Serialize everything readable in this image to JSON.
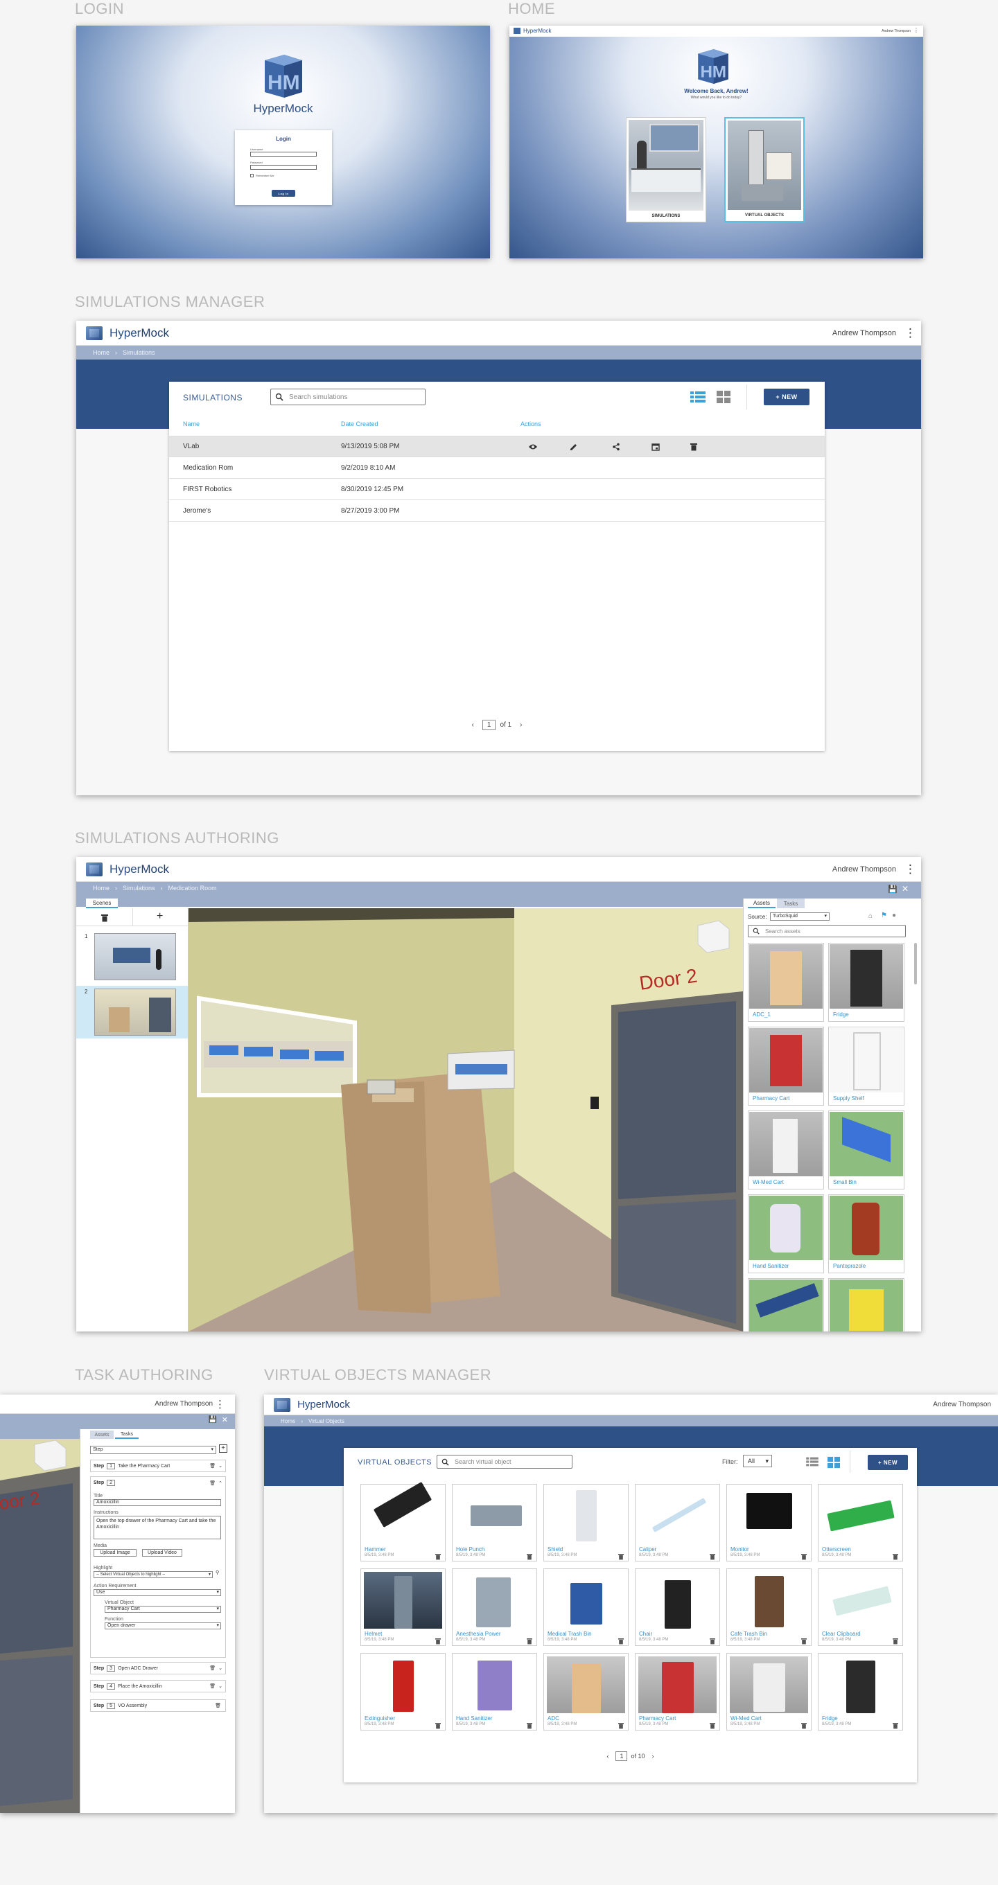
{
  "sections": {
    "login": "LOGIN",
    "home": "HOME",
    "sim_manager": "SIMULATIONS MANAGER",
    "sim_authoring": "SIMULATIONS AUTHORING",
    "task_authoring": "TASK AUTHORING",
    "vo_manager": "VIRTUAL OBJECTS MANAGER"
  },
  "app": {
    "brand_a": "Hyper",
    "brand_b": "Mock",
    "user": "Andrew Thompson"
  },
  "login": {
    "title": "Login",
    "username_label": "Username",
    "password_label": "Password",
    "remember": "Remember Me",
    "button": "Log In"
  },
  "home": {
    "welcome": "Welcome Back, Andrew!",
    "question": "What would you like to do today?",
    "card1": "SIMULATIONS",
    "card2": "VIRTUAL OBJECTS"
  },
  "sim_manager": {
    "breadcrumb": [
      "Home",
      "Simulations"
    ],
    "title": "SIMULATIONS",
    "search_placeholder": "Search simulations",
    "new_label": "+ NEW",
    "columns": [
      "Name",
      "Date Created",
      "Actions"
    ],
    "rows": [
      {
        "name": "VLab",
        "date": "9/13/2019 5:08 PM"
      },
      {
        "name": "Medication Rom",
        "date": "9/2/2019 8:10 AM"
      },
      {
        "name": "FIRST Robotics",
        "date": "8/30/2019 12:45 PM"
      },
      {
        "name": "Jerome's",
        "date": "8/27/2019 3:00 PM"
      }
    ],
    "page": "1",
    "page_of": "of 1"
  },
  "authoring": {
    "breadcrumb": [
      "Home",
      "Simulations",
      "Medication Room"
    ],
    "tab_scenes": "Scenes",
    "scene_numbers": [
      "1",
      "2"
    ],
    "door_label": "Door 2",
    "tab_assets": "Assets",
    "tab_tasks": "Tasks",
    "source_label": "Source:",
    "source_value": "TurboSquid",
    "asset_search": "Search assets",
    "assets": [
      "ADC_1",
      "Fridge",
      "Pharmacy Cart",
      "Supply Shelf",
      "Wi-Med Cart",
      "Small Bin",
      "Hand Sanitizer",
      "Pantoprazole",
      "",
      ""
    ]
  },
  "task": {
    "user": "Andrew Thompson",
    "door_label": "oor 2",
    "tab_assets": "Assets",
    "tab_tasks": "Tasks",
    "step_select": "Step",
    "step_word": "Step",
    "steps": [
      {
        "n": "1",
        "text": "Take the Pharmacy Cart"
      },
      {
        "n": "2",
        "text": ""
      },
      {
        "n": "3",
        "text": "Open ADC Drawer"
      },
      {
        "n": "4",
        "text": "Place the Amoxicillin"
      },
      {
        "n": "5",
        "text": "VO Assembly"
      }
    ],
    "title_label": "Title",
    "title_value": "Amoxicillin",
    "instructions_label": "Instructions",
    "instructions_value": "Open the top drawer of the Pharmacy Cart and take the Amoxicillin",
    "media_label": "Media",
    "upload_image": "Upload Image",
    "upload_video": "Upload Video",
    "highlight_label": "Highlight",
    "highlight_value": "-- Select Virtual Objects to highlight --",
    "action_req_label": "Action Requirement",
    "action_req_value": "Use",
    "vo_label": "Virtual Object",
    "vo_value": "Pharmacy Cart",
    "function_label": "Function",
    "function_value": "Open drawer"
  },
  "vo_manager": {
    "breadcrumb": [
      "Home",
      "Virtual Objects"
    ],
    "title": "VIRTUAL OBJECTS",
    "search_placeholder": "Search virtual object",
    "filter_label": "Filter:",
    "filter_value": "All",
    "new_label": "+ NEW",
    "items": [
      {
        "name": "Hammer",
        "date": "8/5/19, 3:48 PM"
      },
      {
        "name": "Hole Punch",
        "date": "8/5/19, 3:48 PM"
      },
      {
        "name": "Shield",
        "date": "8/5/19, 3:48 PM"
      },
      {
        "name": "Caliper",
        "date": "8/5/19, 3:48 PM"
      },
      {
        "name": "Monitor",
        "date": "8/5/19, 3:48 PM"
      },
      {
        "name": "Otterscreen",
        "date": "8/5/19, 3:48 PM"
      },
      {
        "name": "Helmet",
        "date": "8/5/19, 3:48 PM"
      },
      {
        "name": "Anesthesia Power",
        "date": "8/5/19, 3:48 PM"
      },
      {
        "name": "Medical Trash Bin",
        "date": "8/5/19, 3:48 PM"
      },
      {
        "name": "Chair",
        "date": "8/5/19, 3:48 PM"
      },
      {
        "name": "Cafe Trash Bin",
        "date": "8/5/19, 3:48 PM"
      },
      {
        "name": "Clear Clipboard",
        "date": "8/5/19, 3:48 PM"
      },
      {
        "name": "Extinguisher",
        "date": "8/5/19, 3:48 PM"
      },
      {
        "name": "Hand Sanitizer",
        "date": "8/5/19, 3:48 PM"
      },
      {
        "name": "ADC",
        "date": "8/5/19, 3:48 PM"
      },
      {
        "name": "Pharmacy Cart",
        "date": "8/5/19, 3:48 PM"
      },
      {
        "name": "Wi-Med Cart",
        "date": "8/5/19, 3:48 PM"
      },
      {
        "name": "Fridge",
        "date": "8/5/19, 3:48 PM"
      }
    ],
    "page": "1",
    "page_of": "of 10"
  },
  "colors": {
    "primary": "#2e5187",
    "breadcrumb": "#9daecb",
    "link": "#3da0d6"
  }
}
